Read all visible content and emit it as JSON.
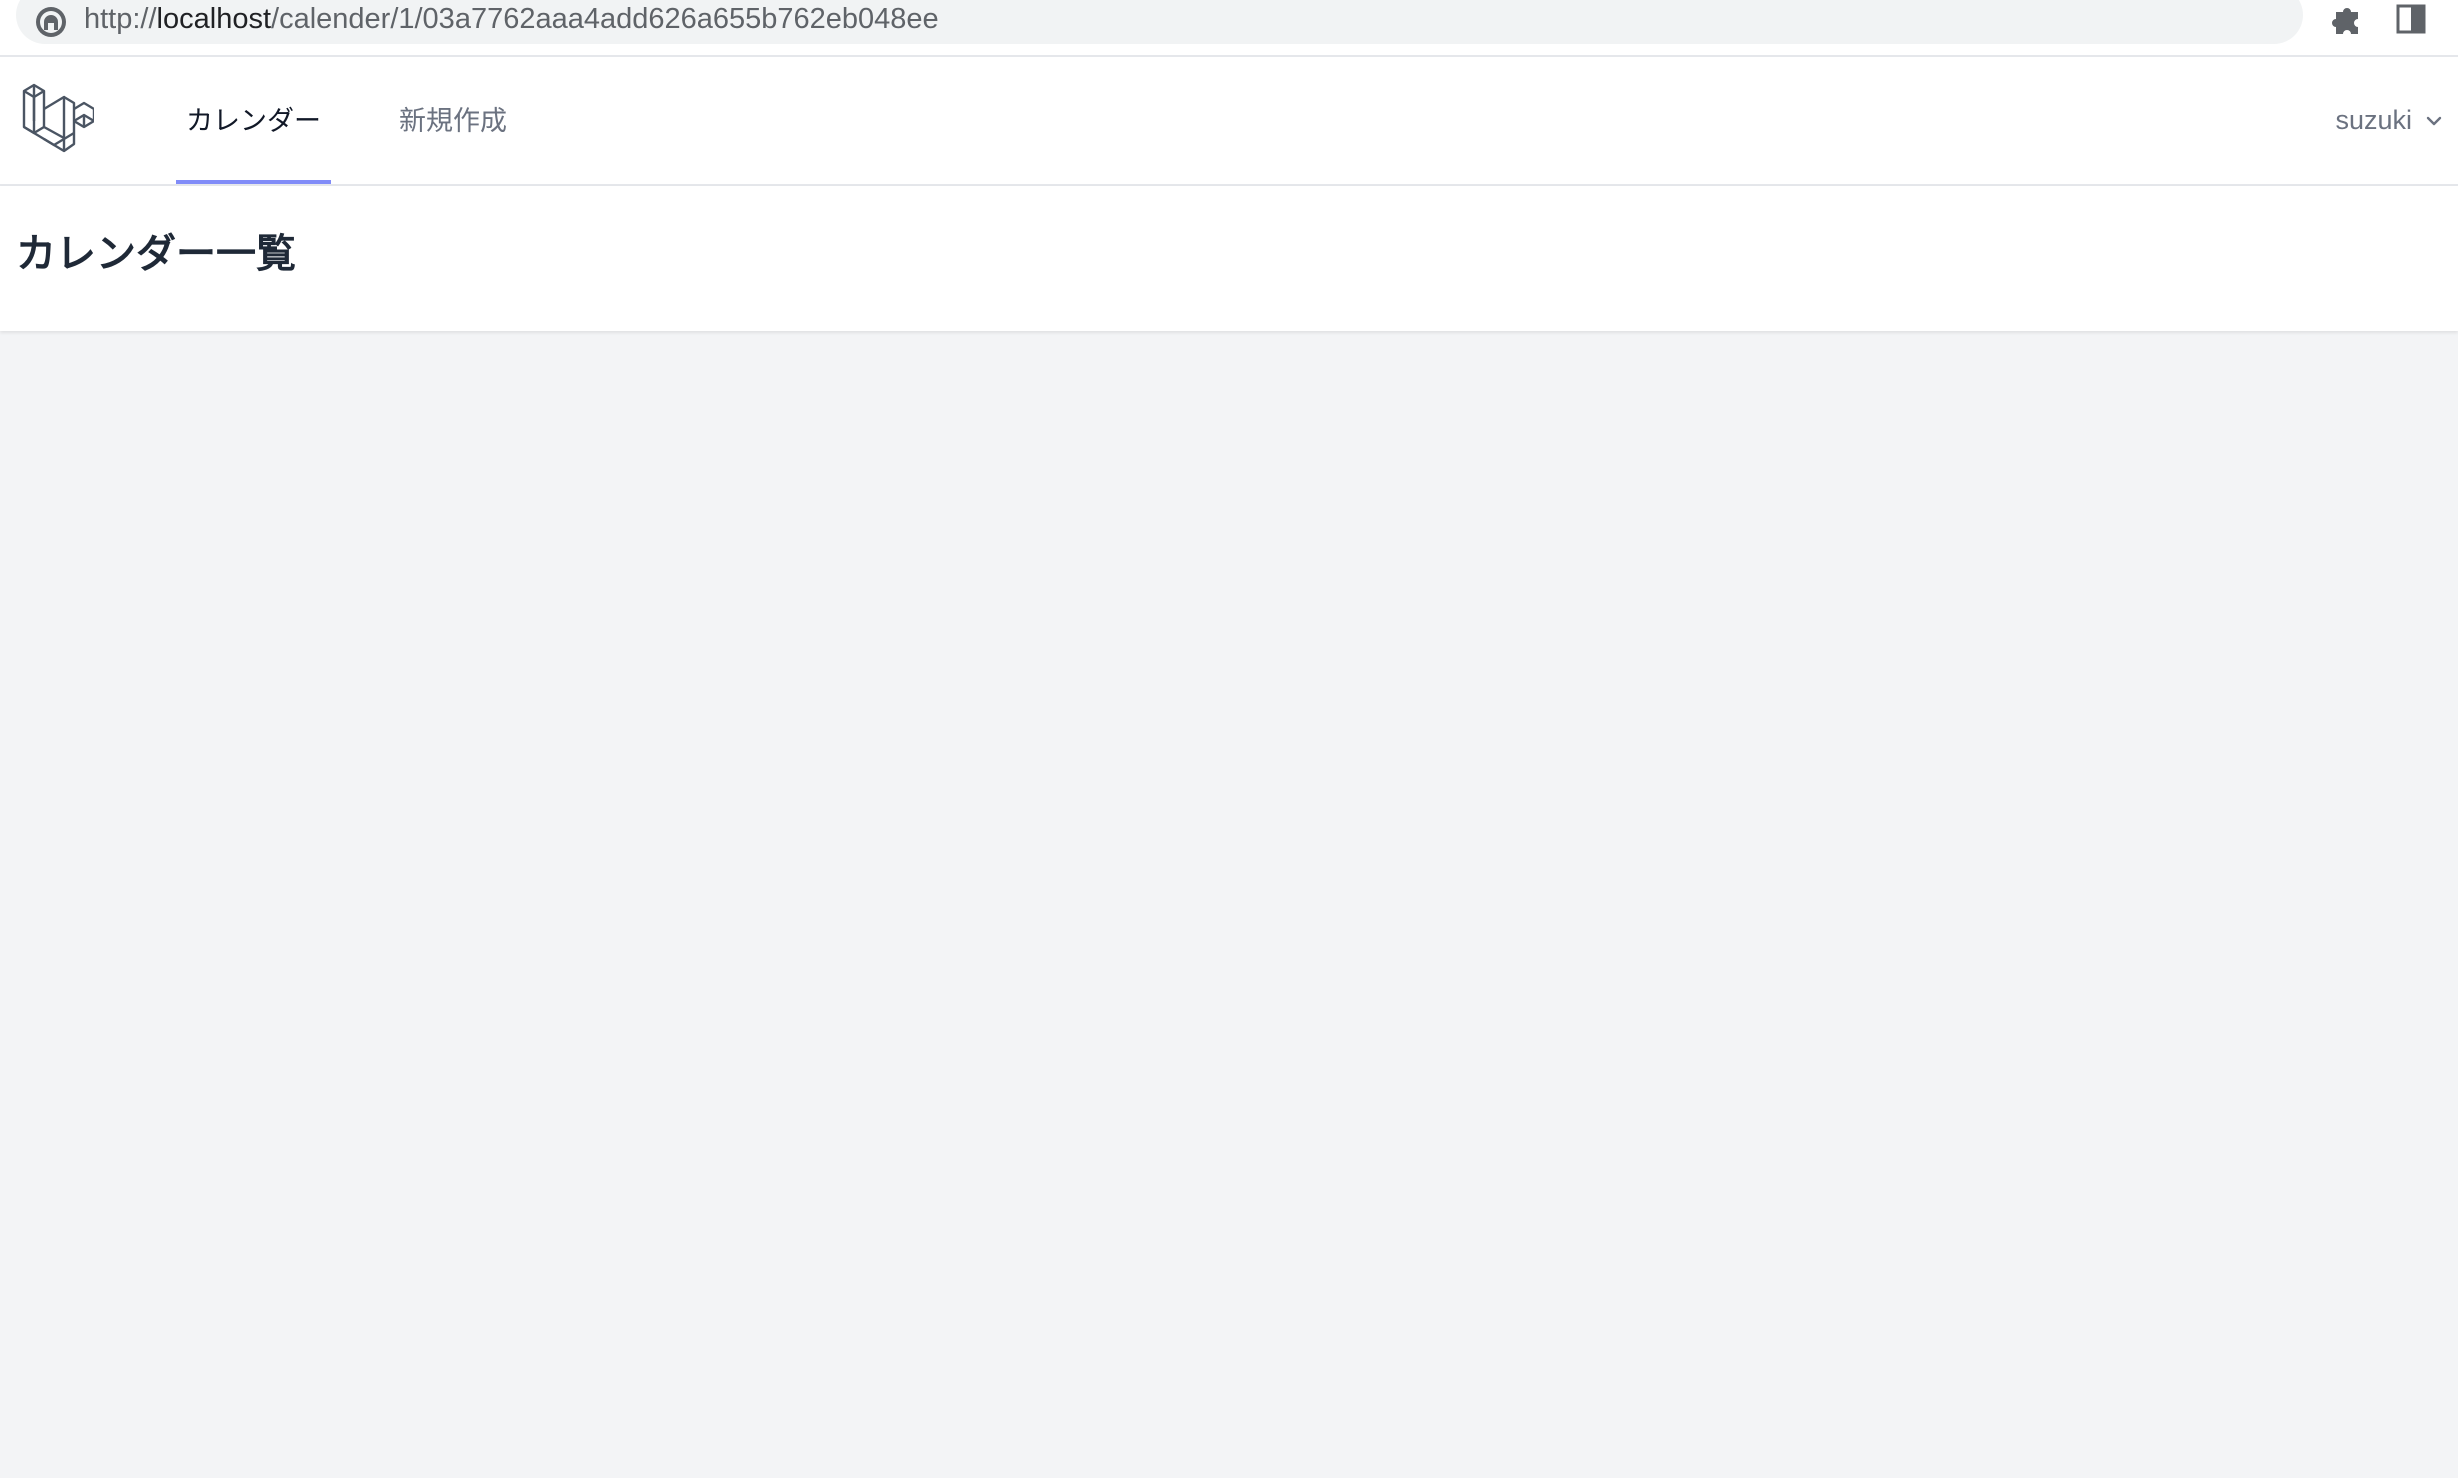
{
  "browser": {
    "url_scheme": "http://",
    "url_host": "localhost",
    "url_path": "/calender/1/03a7762aaa4add626a655b762eb048ee"
  },
  "nav": {
    "links": [
      {
        "label": "カレンダー",
        "active": true
      },
      {
        "label": "新規作成",
        "active": false
      }
    ],
    "user_name": "suzuki"
  },
  "header": {
    "title": "カレンダー一覧"
  },
  "colors": {
    "accent": "#818cf8",
    "background": "#f3f4f6"
  }
}
